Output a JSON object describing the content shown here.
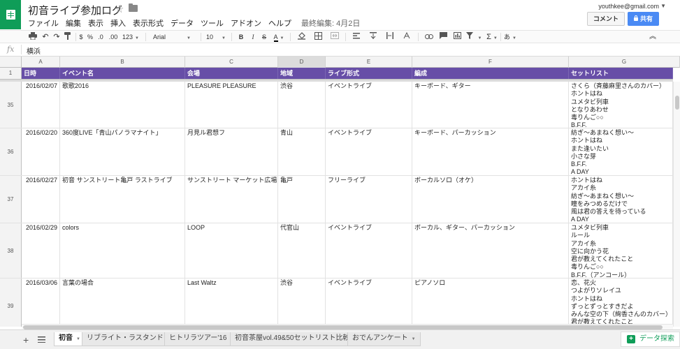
{
  "app": {
    "doc_title": "初音ライブ参加ログ",
    "user_email": "youthkee@gmail.com",
    "comment_label": "コメント",
    "share_label": "共有"
  },
  "menu": {
    "items": [
      "ファイル",
      "編集",
      "表示",
      "挿入",
      "表示形式",
      "データ",
      "ツール",
      "アドオン",
      "ヘルプ"
    ],
    "last_edit": "最終編集: 4月2日"
  },
  "toolbar": {
    "percent": "%",
    "dec_less": ".0",
    "dec_more": ".00",
    "number_format": "123",
    "font": "Arial",
    "size": "10",
    "bold": "B",
    "italic": "I",
    "strike": "S",
    "text_color": "A",
    "input_tools": "あ"
  },
  "formula": {
    "fx": "fx",
    "value": "横浜"
  },
  "columns": [
    "A",
    "B",
    "C",
    "D",
    "E",
    "F",
    "G"
  ],
  "header_row": {
    "number": "1",
    "cells": [
      "日時",
      "イベント名",
      "会場",
      "地域",
      "ライブ形式",
      "編成",
      "セットリスト"
    ]
  },
  "rows": [
    {
      "number": "35",
      "date": "2016/02/07",
      "event": "歌歌2016",
      "venue": "PLEASURE PLEASURE",
      "area": "渋谷",
      "format": "イベントライブ",
      "lineup": "キーボード、ギター",
      "setlist": [
        "さくら（斉藤麻里さんのカバー）",
        "ホントはね",
        "ユメタビ列車",
        "となりあわせ",
        "毒りんご○○",
        "B.F.F."
      ]
    },
    {
      "number": "36",
      "date": "2016/02/20",
      "event": "360度LIVE「青山パノラマナイト」",
      "venue": "月見ル君想フ",
      "area": "青山",
      "format": "イベントライブ",
      "lineup": "キーボード、パーカッション",
      "setlist": [
        "紡ぎ〜あまねく想い〜",
        "ホントはね",
        "また逢いたい",
        "小さな芽",
        "B.F.F.",
        "A DAY"
      ]
    },
    {
      "number": "37",
      "date": "2016/02/27",
      "event": "初音 サンストリート亀戸 ラストライブ",
      "venue": "サンストリート マーケット広場",
      "area": "亀戸",
      "format": "フリーライブ",
      "lineup": "ボーカルソロ（オケ）",
      "setlist": [
        "ホントはね",
        "アカイ糸",
        "紡ぎ〜あまねく想い〜",
        "瞳をみつめるだけで",
        "風は君の答えを待っている",
        "A DAY"
      ]
    },
    {
      "number": "38",
      "date": "2016/02/29",
      "event": "colors",
      "venue": "LOOP",
      "area": "代官山",
      "format": "イベントライブ",
      "lineup": "ボーカル、ギター、パーカッション",
      "setlist": [
        "ユメタビ列車",
        "ルール",
        "アカイ糸",
        "空に向かう花",
        "君が教えてくれたこと",
        "毒りんご○○",
        "B.F.F.（アンコール）"
      ]
    },
    {
      "number": "39",
      "date": "2016/03/06",
      "event": "言葉の場合",
      "venue": "Last Waltz",
      "area": "渋谷",
      "format": "イベントライブ",
      "lineup": "ピアノソロ",
      "setlist": [
        "恋、花火",
        "つよがりソレイユ",
        "ホントはね",
        "ずっとずっとすきだよ",
        "みんな空の下（絢香さんのカバー）",
        "君が教えてくれたこと"
      ]
    }
  ],
  "sheets": {
    "tabs": [
      "初音",
      "リブライト・ラスタンド",
      "ヒトリラツアー'16",
      "初音茶屋vol.49&50セットリスト比較",
      "おでんアンケート"
    ],
    "explore_label": "データ探索"
  },
  "colors": {
    "header_bg": "#674ea7",
    "brand_green": "#0f9d58",
    "share_blue": "#4a8af4"
  }
}
